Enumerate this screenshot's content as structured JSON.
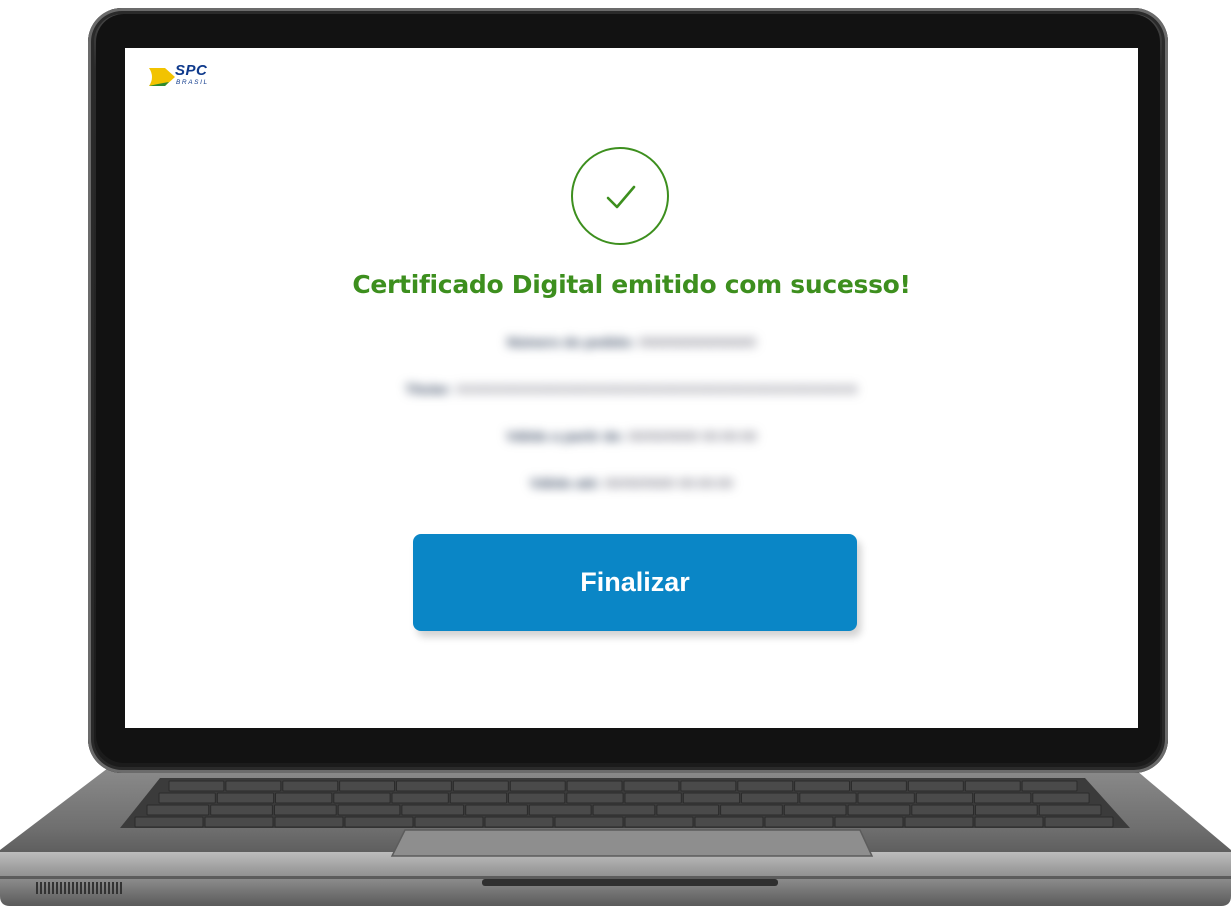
{
  "brand": {
    "name": "SPC",
    "tagline": "BRASIL",
    "colors": {
      "primary": "#0f3a8c",
      "accent": "#f2c300"
    }
  },
  "success": {
    "icon": "check-circle-icon",
    "message": "Certificado Digital emitido com sucesso!",
    "color": "#3d8f1e"
  },
  "details": [
    {
      "label": "Número do pedido:",
      "value": "000000000000000"
    },
    {
      "label": "Titular:",
      "value": "XXXXXXXXXXXXXXXXXXXXXXXXXXXXXXXXXXXXXXXXXXX"
    },
    {
      "label": "Válido a partir de:",
      "value": "00/00/0000 00:00:00"
    },
    {
      "label": "Válido até:",
      "value": "00/00/0000 00:00:00"
    }
  ],
  "actions": {
    "finish_label": "Finalizar",
    "finish_color": "#0a86c6"
  }
}
